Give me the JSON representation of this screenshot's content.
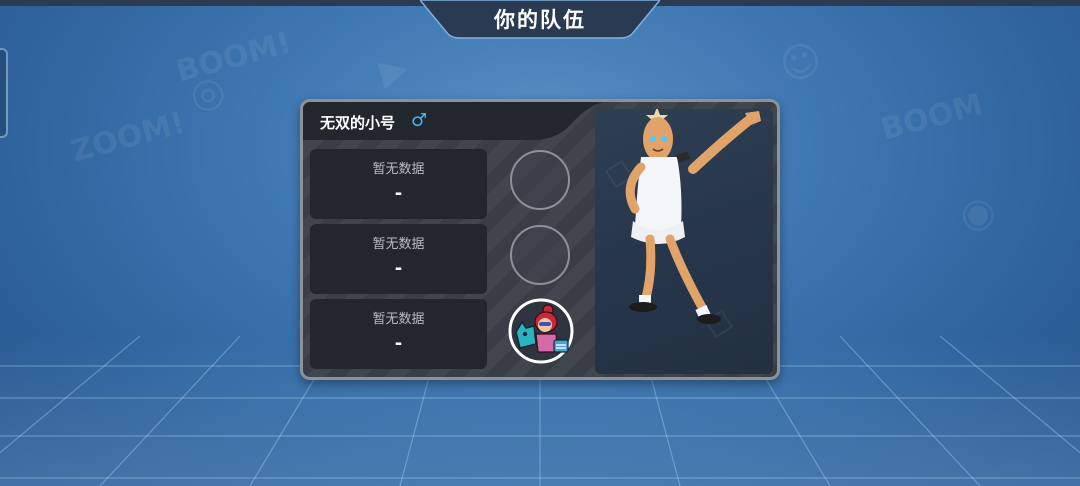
{
  "screen": {
    "title": "你的队伍"
  },
  "player": {
    "name": "无双的小号",
    "gender_symbol": "♂",
    "gender": "male"
  },
  "stats": [
    {
      "label": "暂无数据",
      "value": "-"
    },
    {
      "label": "暂无数据",
      "value": "-"
    },
    {
      "label": "暂无数据",
      "value": "-"
    }
  ],
  "slots": [
    {
      "state": "empty"
    },
    {
      "state": "empty"
    },
    {
      "state": "filled",
      "icon": "girl-with-dog-avatar-icon"
    }
  ],
  "portrait": {
    "icon": "sausage-character-cheering-icon"
  },
  "colors": {
    "background": "#3f78b3",
    "card": "#3a3f48",
    "title_tab": "#2a3a52",
    "gender": "#3fb8ff"
  }
}
